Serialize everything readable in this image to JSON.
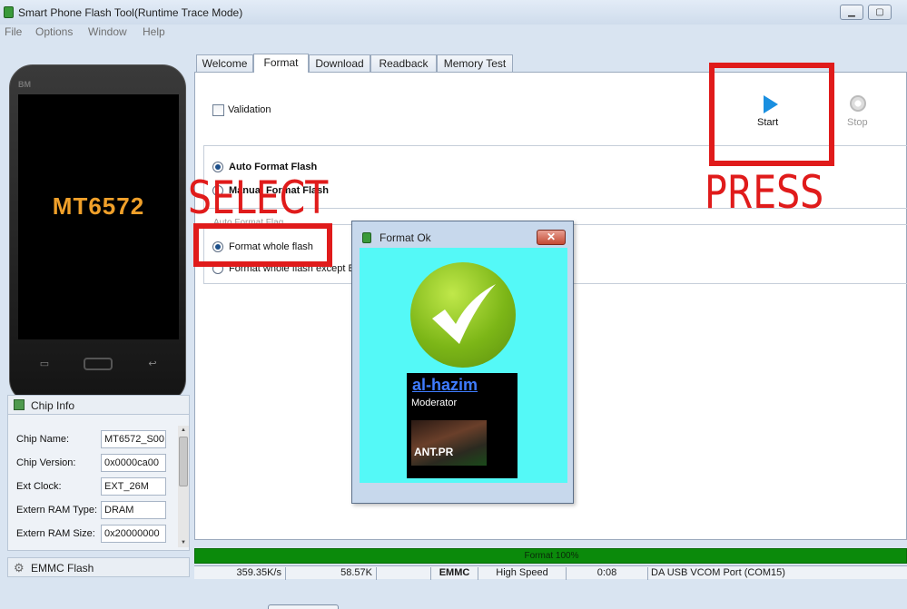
{
  "window": {
    "title": "Smart Phone Flash Tool(Runtime Trace Mode)",
    "min_glyph": "▁",
    "max_glyph": "▢"
  },
  "menu": [
    "File",
    "Options",
    "Window",
    "Help"
  ],
  "phone": {
    "brand": "BM",
    "model": "MT6572",
    "left_key": "▭",
    "back_key": "↩"
  },
  "chip_info": {
    "title": "Chip Info",
    "rows": [
      {
        "label": "Chip Name:",
        "value": "MT6572_S00"
      },
      {
        "label": "Chip Version:",
        "value": "0x0000ca00"
      },
      {
        "label": "Ext Clock:",
        "value": "EXT_26M"
      },
      {
        "label": "Extern RAM Type:",
        "value": "DRAM"
      },
      {
        "label": "Extern RAM Size:",
        "value": "0x20000000"
      }
    ]
  },
  "emmc_flash": {
    "title": "EMMC Flash",
    "icon": "gear-icon"
  },
  "tabs": [
    "Welcome",
    "Format",
    "Download",
    "Readback",
    "Memory Test"
  ],
  "active_tab": "Format",
  "format": {
    "validation_label": "Validation",
    "start_label": "Start",
    "stop_label": "Stop",
    "auto_format_label": "Auto Format Flash",
    "manual_format_label": "Manual Format Flash",
    "auto_format_flag_title": "Auto Format Flag",
    "whole_flash_label": "Format whole flash",
    "except_label": "Format whole flash except B"
  },
  "annotations": {
    "select": "SELECT",
    "press": "PRESS",
    "color": "#e01b1b"
  },
  "dialog": {
    "title": "Format Ok",
    "close_glyph": "✕",
    "signature_name": "al-hazim",
    "signature_role": "Moderator",
    "signature_image_text": "ANT.PR"
  },
  "progress": {
    "text": "Format 100%",
    "percent": 100,
    "color": "#0b8a0b"
  },
  "status": {
    "speed": "359.35K/s",
    "size": "58.57K",
    "storage": "EMMC",
    "usb_speed": "High Speed",
    "time": "0:08",
    "port": "DA USB VCOM Port (COM15)"
  }
}
